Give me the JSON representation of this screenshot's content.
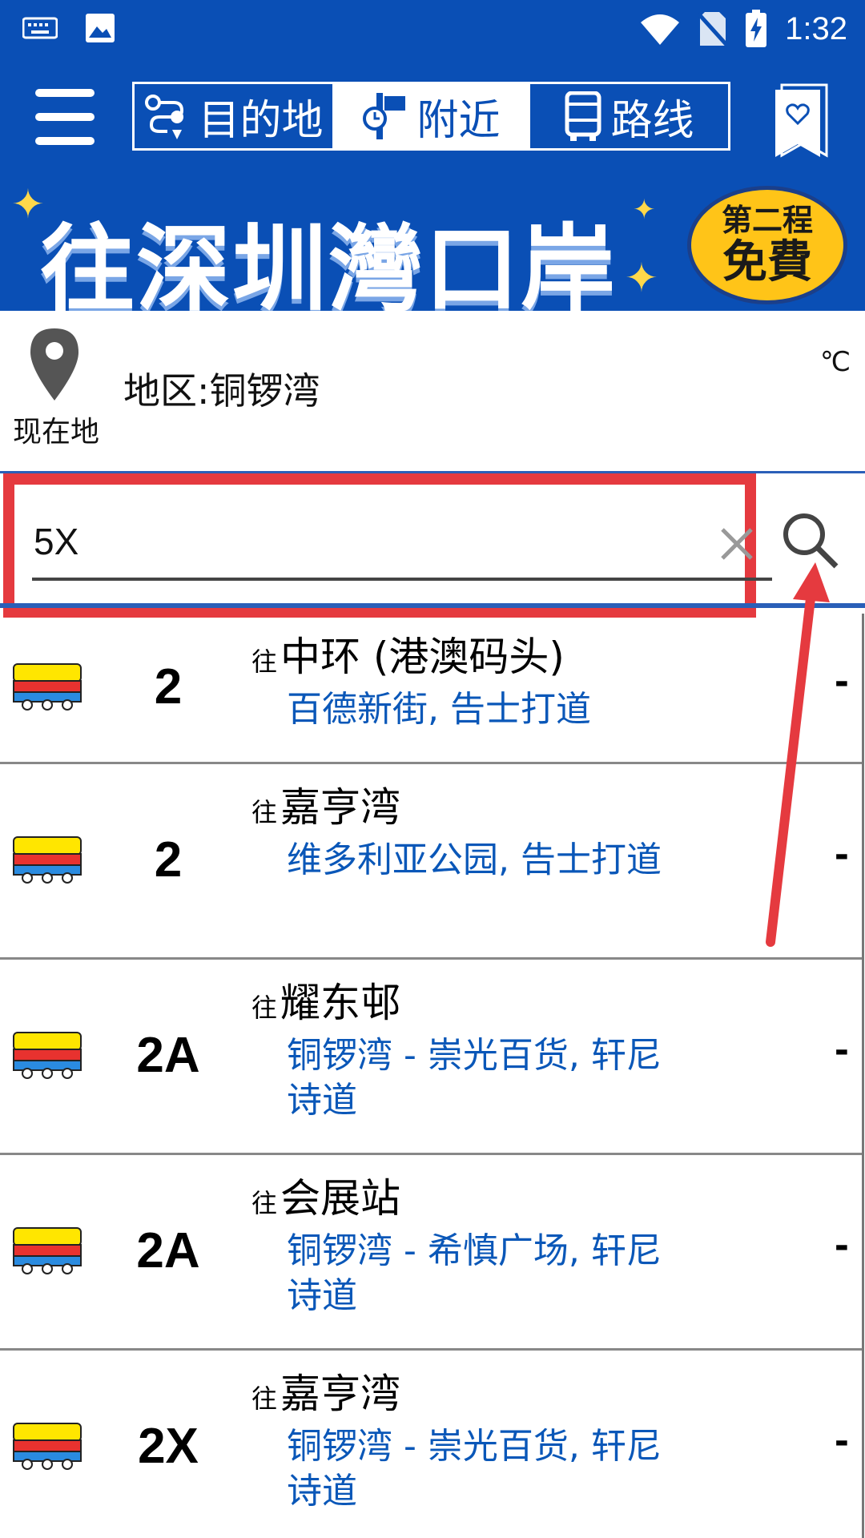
{
  "status_bar": {
    "time": "1:32",
    "icons": [
      "keyboard-icon",
      "image-icon",
      "wifi-icon",
      "no-sim-icon",
      "battery-charging-icon"
    ]
  },
  "app_bar": {
    "tabs": [
      {
        "label": "目的地",
        "icon": "destination-icon",
        "active": false
      },
      {
        "label": "附近",
        "icon": "nearby-icon",
        "active": true
      },
      {
        "label": "路线",
        "icon": "bus-route-icon",
        "active": false
      }
    ],
    "menu_icon": "hamburger-menu-icon",
    "favorites_icon": "bookmark-heart-icon"
  },
  "banner": {
    "headline": "往深圳灣口岸",
    "badge_line1": "第二程",
    "badge_line2": "免費"
  },
  "location": {
    "current_label": "现在地",
    "district": "地区:铜锣湾",
    "temperature_unit": "℃"
  },
  "search": {
    "value": "5X",
    "placeholder": ""
  },
  "routes": [
    {
      "number": "2",
      "to_label": "往",
      "destination": "中环 (港澳码头)",
      "stop": "百德新街, 告士打道",
      "eta": "-"
    },
    {
      "number": "2",
      "to_label": "往",
      "destination": "嘉亨湾",
      "stop": "维多利亚公园, 告士打道",
      "eta": "-"
    },
    {
      "number": "2A",
      "to_label": "往",
      "destination": "耀东邨",
      "stop": "铜锣湾 - 崇光百货, 轩尼诗道",
      "eta": "-"
    },
    {
      "number": "2A",
      "to_label": "往",
      "destination": "会展站",
      "stop": "铜锣湾 - 希慎广场, 轩尼诗道",
      "eta": "-"
    },
    {
      "number": "2X",
      "to_label": "往",
      "destination": "嘉亨湾",
      "stop": "铜锣湾 - 崇光百货, 轩尼诗道",
      "eta": "-"
    }
  ],
  "colors": {
    "brand_blue": "#0a4fb5",
    "highlight_red": "#e53a3f",
    "stop_blue": "#0a57b8",
    "bus_yellow": "#ffe600",
    "bus_red": "#e8322f",
    "bus_blue": "#2a8be0"
  }
}
